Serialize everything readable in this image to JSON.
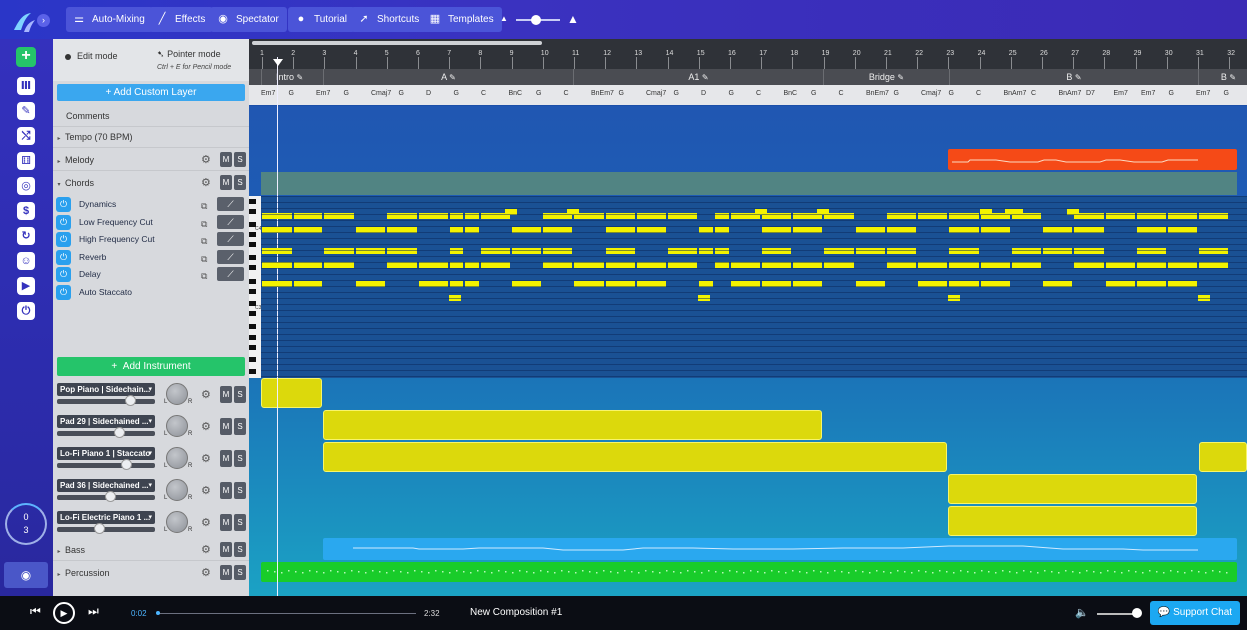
{
  "toolbar": {
    "auto_mixing": "Auto-Mixing",
    "effects": "Effects",
    "spectator": "Spectator",
    "tutorial": "Tutorial",
    "shortcuts": "Shortcuts",
    "templates": "Templates",
    "zoom_level": 0.45
  },
  "modes": {
    "edit": "Edit mode",
    "pointer": "Pointer mode",
    "pointer_hint": "Ctrl + E for Pencil mode"
  },
  "add_custom_layer": "+ Add Custom Layer",
  "comments": "Comments",
  "tempo": "Tempo (70 BPM)",
  "melody": "Melody",
  "chords": "Chords",
  "effects": [
    "Dynamics",
    "Low Frequency Cut",
    "High Frequency Cut",
    "Reverb",
    "Delay",
    "Auto Staccato"
  ],
  "add_instrument": "Add Instrument",
  "instruments": [
    {
      "name": "Pop Piano | Sidechain...",
      "volume": 0.75
    },
    {
      "name": "Pad 29 | Sidechained ...",
      "volume": 0.64
    },
    {
      "name": "Lo-Fi Piano 1 | Staccato",
      "volume": 0.71
    },
    {
      "name": "Pad 36 | Sidechained ...",
      "volume": 0.55
    },
    {
      "name": "Lo-Fi Electric Piano 1 ...",
      "volume": 0.44
    }
  ],
  "bass": "Bass",
  "percussion": "Percussion",
  "mute_label": "M",
  "solo_label": "S",
  "pan_left": "L",
  "pan_right": "R",
  "ring": {
    "top": "0",
    "bottom": "3"
  },
  "ruler": [
    "1",
    "2",
    "3",
    "4",
    "5",
    "6",
    "7",
    "8",
    "9",
    "10",
    "11",
    "12",
    "13",
    "14",
    "15",
    "16",
    "17",
    "18",
    "19",
    "20",
    "21",
    "22",
    "23",
    "24",
    "25",
    "26",
    "27",
    "28",
    "29",
    "30",
    "31",
    "32"
  ],
  "sections": [
    "Intro",
    "A",
    "A1",
    "Bridge",
    "B",
    "B"
  ],
  "chord_symbols": [
    "Em7",
    "G",
    "Em7",
    "G",
    "Cmaj7",
    "G",
    "D",
    "G",
    "C",
    "BnC",
    "G",
    "C",
    "BnEm7",
    "G",
    "Cmaj7",
    "G",
    "D",
    "G",
    "C",
    "BnC",
    "G",
    "C",
    "BnEm7",
    "G",
    "Cmaj7",
    "G",
    "C",
    "BnAm7",
    "C",
    "BnAm7",
    "D7",
    "Em7",
    "Em7",
    "G",
    "Em7",
    "G"
  ],
  "piano_labels": [
    "C4",
    "C3"
  ],
  "player": {
    "current_time": "0:02",
    "total_time": "2:32",
    "progress": 0.01,
    "composition": "New Composition #1",
    "volume": 0.85,
    "support_chat": "Support Chat"
  },
  "colors": {
    "melody": "#f54a17",
    "notes": "#f3f300",
    "bass": "#2aa8ef",
    "percussion": "#19cc2a",
    "accent": "#3aa7ef",
    "add_instrument": "#25c46a"
  }
}
